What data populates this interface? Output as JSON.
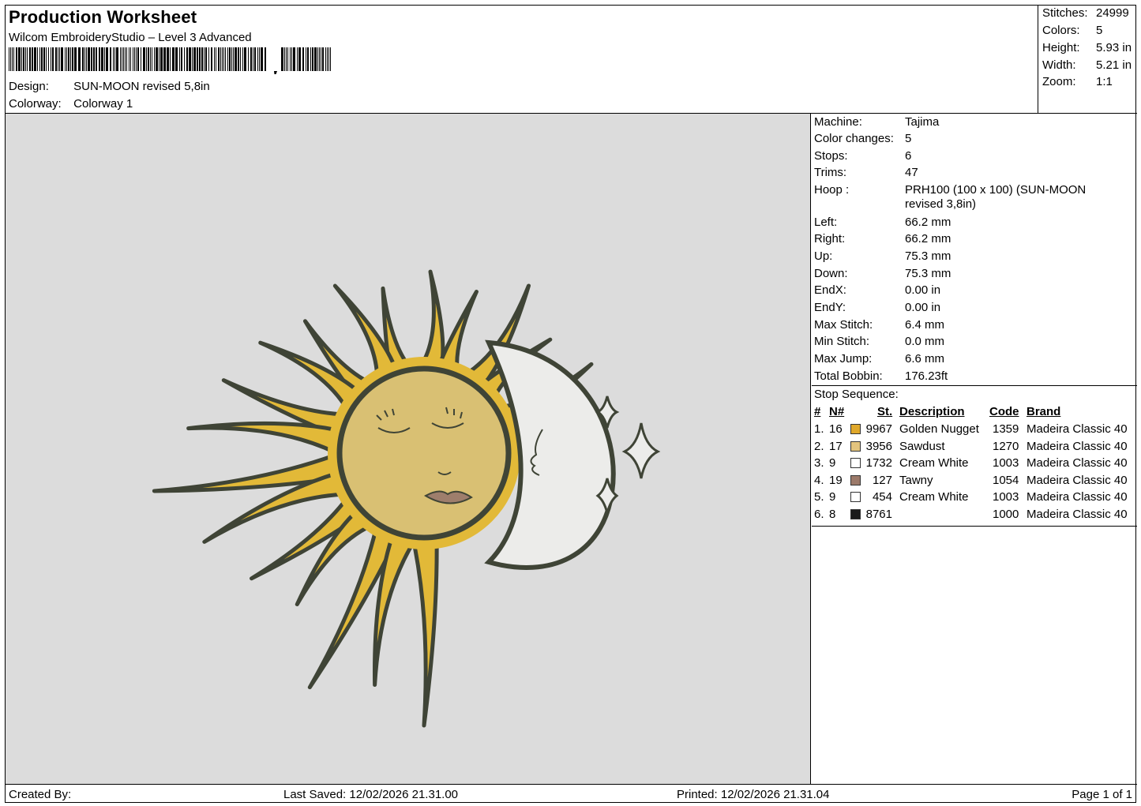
{
  "header": {
    "title": "Production Worksheet",
    "software": "Wilcom EmbroideryStudio – Level 3 Advanced",
    "design_label": "Design:",
    "design_value": "SUN-MOON revised 5,8in",
    "colorway_label": "Colorway:",
    "colorway_value": "Colorway 1"
  },
  "stats": [
    {
      "label": "Stitches:",
      "value": "24999"
    },
    {
      "label": "Colors:",
      "value": "5"
    },
    {
      "label": "Height:",
      "value": "5.93 in"
    },
    {
      "label": "Width:",
      "value": "5.21 in"
    },
    {
      "label": "Zoom:",
      "value": "1:1"
    }
  ],
  "machine_info": [
    {
      "label": "Machine:",
      "value": "Tajima"
    },
    {
      "label": "Color changes:",
      "value": "5"
    },
    {
      "label": "Stops:",
      "value": "6"
    },
    {
      "label": "Trims:",
      "value": "47"
    },
    {
      "label": "Hoop :",
      "value": "PRH100 (100 x 100) (SUN-MOON revised 3,8in)"
    },
    {
      "label": "Left:",
      "value": "66.2 mm"
    },
    {
      "label": "Right:",
      "value": "66.2 mm"
    },
    {
      "label": "Up:",
      "value": "75.3 mm"
    },
    {
      "label": "Down:",
      "value": "75.3 mm"
    },
    {
      "label": "EndX:",
      "value": "0.00 in"
    },
    {
      "label": "EndY:",
      "value": "0.00 in"
    },
    {
      "label": "Max Stitch:",
      "value": "6.4 mm"
    },
    {
      "label": "Min Stitch:",
      "value": "0.0 mm"
    },
    {
      "label": "Max Jump:",
      "value": "6.6 mm"
    },
    {
      "label": "Total Bobbin:",
      "value": "176.23ft"
    }
  ],
  "stop_sequence": {
    "title": "Stop Sequence:",
    "headers": {
      "num": "#",
      "needle": "N#",
      "st": "St.",
      "description": "Description",
      "code": "Code",
      "brand": "Brand"
    },
    "rows": [
      {
        "num": "1.",
        "needle": "16",
        "color": "#e0a82a",
        "st": "9967",
        "description": "Golden Nugget",
        "code": "1359",
        "brand": "Madeira Classic 40"
      },
      {
        "num": "2.",
        "needle": "17",
        "color": "#e3c47e",
        "st": "3956",
        "description": "Sawdust",
        "code": "1270",
        "brand": "Madeira Classic 40"
      },
      {
        "num": "3.",
        "needle": "9",
        "color": "#ffffff",
        "st": "1732",
        "description": "Cream White",
        "code": "1003",
        "brand": "Madeira Classic 40"
      },
      {
        "num": "4.",
        "needle": "19",
        "color": "#9c7a6a",
        "st": "127",
        "description": "Tawny",
        "code": "1054",
        "brand": "Madeira Classic 40"
      },
      {
        "num": "5.",
        "needle": "9",
        "color": "#ffffff",
        "st": "454",
        "description": "Cream White",
        "code": "1003",
        "brand": "Madeira Classic 40"
      },
      {
        "num": "6.",
        "needle": "8",
        "color": "#1a1a1a",
        "st": "8761",
        "description": "",
        "code": "1000",
        "brand": "Madeira Classic 40"
      }
    ]
  },
  "footer": {
    "created_by": "Created By:",
    "last_saved": "Last Saved: 12/02/2026 21.31.00",
    "printed": "Printed: 12/02/2026 21.31.04",
    "page": "Page 1 of 1"
  },
  "colors": {
    "canvas_bg": "#dcdcdc",
    "sun_rays": "#e2b938",
    "sun_face": "#d9c073",
    "moon": "#ececea",
    "outline": "#3f4436",
    "lips": "#9e7e6c"
  }
}
